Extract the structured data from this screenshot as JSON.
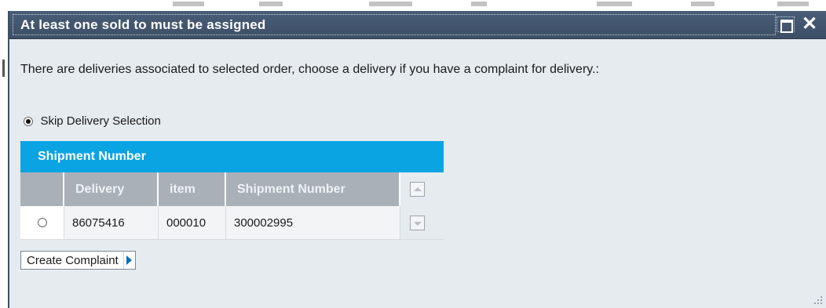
{
  "dialog": {
    "title": "At least one sold to must be assigned",
    "maximize_icon": "maximize-icon",
    "close_glyph": "✕",
    "message": "There are deliveries associated to selected order, choose a delivery if you have a complaint for delivery.:",
    "skip_option": {
      "label": "Skip Delivery Selection",
      "selected": true
    }
  },
  "table": {
    "title": "Shipment Number",
    "columns": [
      "Delivery",
      "item",
      "Shipment Number"
    ],
    "rows": [
      {
        "selected": false,
        "delivery": "86075416",
        "item": "000010",
        "shipment": "300002995"
      }
    ]
  },
  "actions": {
    "create_complaint": "Create Complaint"
  },
  "colors": {
    "titlebar": "#3d4f66",
    "dialog_bg": "#e6ebf0",
    "table_title_bg": "#0aa4e3",
    "column_header_bg": "#a9b0b8"
  }
}
